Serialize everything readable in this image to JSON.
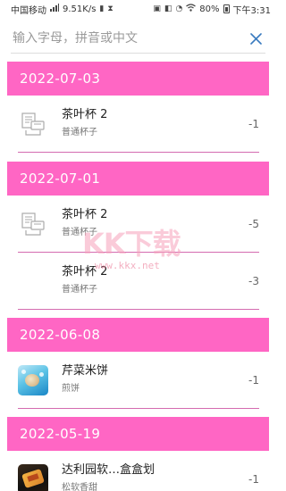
{
  "status_bar": {
    "carrier": "中国移动",
    "network": "4G",
    "speed": "9.51K/s",
    "battery": "80%",
    "time": "下午3:31"
  },
  "search": {
    "placeholder": "输入字母，拼音或中文"
  },
  "groups": [
    {
      "date": "2022-07-03",
      "items": [
        {
          "name": "茶叶杯 2",
          "sub": "普通杯子",
          "count": "-1",
          "icon": "cup-placeholder-icon"
        }
      ]
    },
    {
      "date": "2022-07-01",
      "items": [
        {
          "name": "茶叶杯 2",
          "sub": "普通杯子",
          "count": "-5",
          "icon": "cup-placeholder-icon"
        },
        {
          "name": "茶叶杯 2",
          "sub": "普通杯子",
          "count": "-3",
          "icon": ""
        }
      ]
    },
    {
      "date": "2022-06-08",
      "items": [
        {
          "name": "芹菜米饼",
          "sub": "煎饼",
          "count": "-1",
          "icon": "food-photo"
        }
      ]
    },
    {
      "date": "2022-05-19",
      "items": [
        {
          "name": "达利园软…盒盒划",
          "sub": "松软香甜",
          "count": "-1",
          "icon": "snack-box-photo"
        }
      ]
    }
  ],
  "watermark": {
    "logo": "KK下载",
    "url": "www.kkx.net"
  },
  "colors": {
    "header_pink": "#ff66c4",
    "divider": "#d46bb0",
    "close_icon": "#3a7bbf"
  }
}
